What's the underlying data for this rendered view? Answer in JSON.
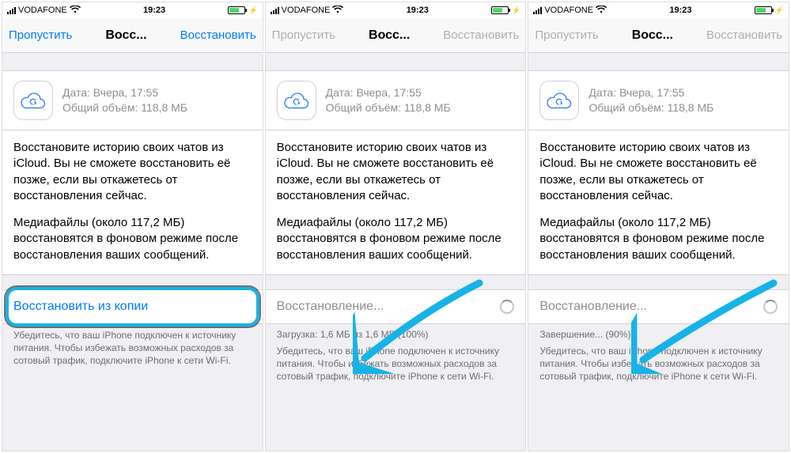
{
  "statusbar": {
    "carrier": "VODAFONE",
    "time": "19:23"
  },
  "backup": {
    "date_label": "Дата:",
    "date_value": "Вчера, 17:55",
    "size_label": "Общий объём:",
    "size_value": "118,8 МБ"
  },
  "description": {
    "p1": "Восстановите историю своих чатов из iCloud. Вы не сможете восстановить её позже, если вы откажетесь от восстановления сейчас.",
    "p2": "Медиафайлы (около 117,2 МБ) восстановятся в фоновом режиме после восстановления ваших сообщений."
  },
  "footer": "Убедитесь, что ваш iPhone подключен к источнику питания. Чтобы избежать возможных расходов за сотовый трафик, подключите iPhone к сети Wi-Fi.",
  "screens": [
    {
      "nav": {
        "left": "Пропустить",
        "title": "Восс...",
        "right": "Восстановить",
        "enabled": true
      },
      "action": {
        "label": "Восстановить из копии",
        "state": "idle"
      }
    },
    {
      "nav": {
        "left": "Пропустить",
        "title": "Восс...",
        "right": "Восстановить",
        "enabled": false
      },
      "action": {
        "label": "Восстановление...",
        "state": "loading"
      },
      "progress": "Загрузка: 1,6 МБ из 1,6 МБ (100%)"
    },
    {
      "nav": {
        "left": "Пропустить",
        "title": "Восс...",
        "right": "Восстановить",
        "enabled": false
      },
      "action": {
        "label": "Восстановление...",
        "state": "loading"
      },
      "progress": "Завершение... (90%)"
    }
  ]
}
